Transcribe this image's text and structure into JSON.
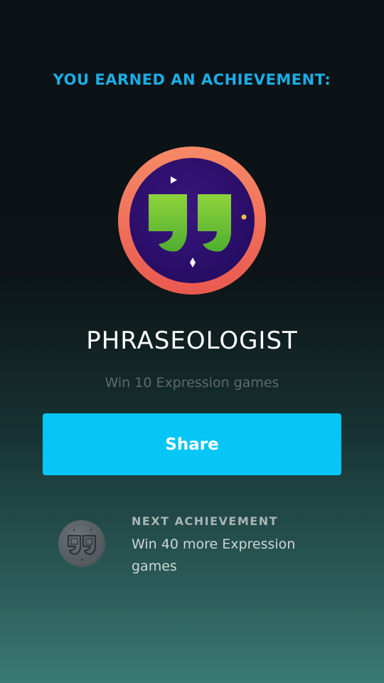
{
  "header": {
    "text": "YOU EARNED AN ACHIEVEMENT:"
  },
  "achievement": {
    "badge_icon": "quotation-marks-badge-icon",
    "title": "PHRASEOLOGIST",
    "description": "Win 10 Expression games"
  },
  "actions": {
    "share_label": "Share"
  },
  "next_achievement": {
    "label": "NEXT ACHIEVEMENT",
    "description": "Win 40 more Expression games",
    "badge_icon": "locked-quotation-badge-icon"
  },
  "colors": {
    "header": "#1aaee5",
    "share_button": "#06c5f7",
    "badge_ring": "#f2705a",
    "badge_inner": "#2a0f6e",
    "quote_green": "#7ecb3a"
  }
}
